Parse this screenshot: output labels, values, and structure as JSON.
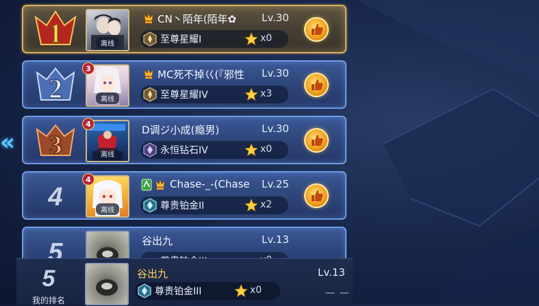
{
  "colors": {
    "gold_frame": "#d8b160",
    "blue_frame": "#6d9ce6",
    "my_name": "#ffd35a"
  },
  "nav": {
    "back_icon": "double-chevron-left-icon",
    "back_glyph": "«"
  },
  "rows": [
    {
      "rank": "1",
      "name": "CN丶陌年(陌年✿",
      "level": "Lv.30",
      "tier": "至尊星耀I",
      "stars": "x0",
      "status": "离线",
      "star_level": "",
      "has_vip": true,
      "has_guard": false
    },
    {
      "rank": "2",
      "name": "MC死不掉巜(『邪性",
      "level": "Lv.30",
      "tier": "至尊星耀IV",
      "stars": "x3",
      "status": "离线",
      "star_level": "3",
      "has_vip": true,
      "has_guard": false
    },
    {
      "rank": "3",
      "name": "D调ジ小成(瘾男)",
      "level": "Lv.30",
      "tier": "永恒钻石IV",
      "stars": "x0",
      "status": "离线",
      "star_level": "4",
      "has_vip": false,
      "has_guard": false
    },
    {
      "rank": "4",
      "name": "Chase-_-(Chase",
      "level": "Lv.25",
      "tier": "尊贵铂金II",
      "stars": "x2",
      "status": "离线",
      "star_level": "4",
      "has_vip": true,
      "has_guard": true
    },
    {
      "rank": "5",
      "name": "谷出九",
      "level": "Lv.13",
      "tier": "尊贵铂金III",
      "stars": "x0",
      "status": "",
      "star_level": "",
      "has_vip": false,
      "has_guard": false
    }
  ],
  "my_rank": {
    "rank": "5",
    "label": "我的排名",
    "name": "谷出九",
    "level": "Lv.13",
    "tier": "尊贵铂金III",
    "stars": "x0",
    "extra": "— —"
  }
}
